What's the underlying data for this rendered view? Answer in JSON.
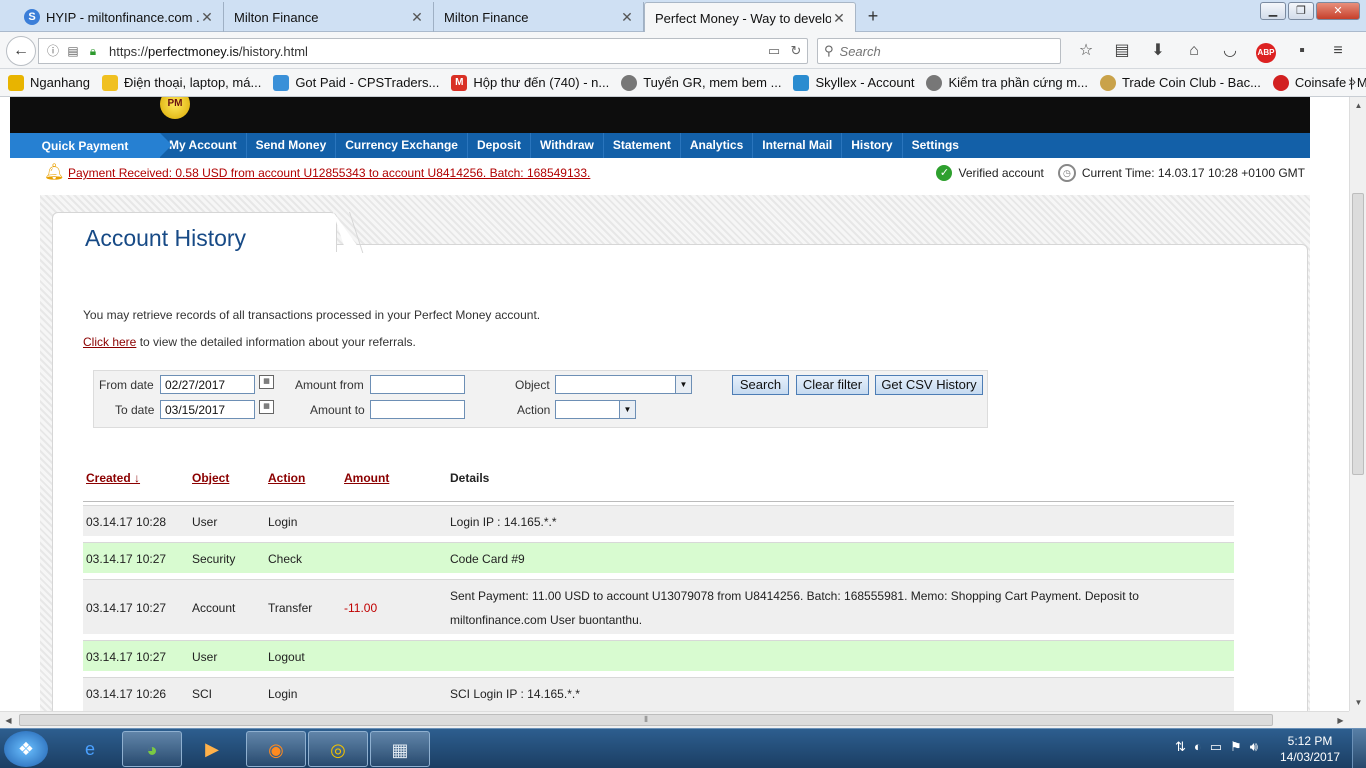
{
  "browser": {
    "tabs": [
      {
        "title": "HYIP - miltonfinance.com ...",
        "icon": "S"
      },
      {
        "title": "Milton Finance",
        "icon": ""
      },
      {
        "title": "Milton Finance",
        "icon": ""
      },
      {
        "title": "Perfect Money - Way to develo...",
        "icon": ""
      }
    ],
    "url_prefix": "https://",
    "url_host": "perfectmoney.is",
    "url_path": "/history.html",
    "search_placeholder": "Search",
    "bookmarks": [
      {
        "label": "Nganhang",
        "color": "#e8b400"
      },
      {
        "label": "Điện thoại, laptop, má...",
        "color": "#f0c020"
      },
      {
        "label": "Got Paid - CPSTraders...",
        "color": "#3a90d8"
      },
      {
        "label": "Hộp thư đến (740) - n...",
        "color": "#d93025"
      },
      {
        "label": "Tuyển GR, mem bem ...",
        "color": "#777777"
      },
      {
        "label": "Skyllex - Account",
        "color": "#2a8cd0"
      },
      {
        "label": "Kiểm tra phần cứng m...",
        "color": "#777777"
      },
      {
        "label": "Trade Coin Club - Bac...",
        "color": "#c9a24a"
      },
      {
        "label": "Coinsafe | My Accoun...",
        "color": "#d22020"
      }
    ]
  },
  "pm": {
    "logo_text": "PM",
    "quick_payment": "Quick Payment",
    "nav": [
      "My Account",
      "Send Money",
      "Currency Exchange",
      "Deposit",
      "Withdraw",
      "Statement",
      "Analytics",
      "Internal Mail",
      "History",
      "Settings"
    ],
    "notification": "Payment Received: 0.58 USD from account U12855343 to account U8414256. Batch: 168549133.",
    "verified": "Verified account",
    "current_time": "Current Time: 14.03.17 10:28 +0100 GMT",
    "page_title": "Account History",
    "intro": "You may retrieve records of all transactions processed in your Perfect Money account.",
    "referral_link": "Click here",
    "referral_rest": " to view the detailed information about your referrals."
  },
  "filter": {
    "from_date_label": "From date",
    "from_date": "02/27/2017",
    "to_date_label": "To date",
    "to_date": "03/15/2017",
    "amount_from_label": "Amount from",
    "amount_to_label": "Amount to",
    "object_label": "Object",
    "action_label": "Action",
    "search_btn": "Search",
    "clear_btn": "Clear filter",
    "csv_btn": "Get CSV History"
  },
  "table": {
    "headers": {
      "created": "Created ↓",
      "object": "Object",
      "action": "Action",
      "amount": "Amount",
      "details": "Details"
    },
    "rows": [
      {
        "created": "03.14.17 10:28",
        "object": "User",
        "action": "Login",
        "amount": "",
        "details": "Login IP : 14.165.*.*",
        "details2": ""
      },
      {
        "created": "03.14.17 10:27",
        "object": "Security",
        "action": "Check",
        "amount": "",
        "details": "Code Card #9",
        "details2": ""
      },
      {
        "created": "03.14.17 10:27",
        "object": "Account",
        "action": "Transfer",
        "amount": "-11.00",
        "details": "Sent Payment: 11.00 USD to account U13079078 from U8414256. Batch: 168555981. Memo: Shopping Cart Payment. Deposit to",
        "details2": "miltonfinance.com User buontanthu."
      },
      {
        "created": "03.14.17 10:27",
        "object": "User",
        "action": "Logout",
        "amount": "",
        "details": "",
        "details2": ""
      },
      {
        "created": "03.14.17 10:26",
        "object": "SCI",
        "action": "Login",
        "amount": "",
        "details": "SCI Login IP : 14.165.*.*",
        "details2": ""
      }
    ],
    "row_colors": {
      "gray": "#efefef",
      "green": "#d8fbd0"
    }
  },
  "taskbar": {
    "time": "5:12 PM",
    "date": "14/03/2017"
  }
}
